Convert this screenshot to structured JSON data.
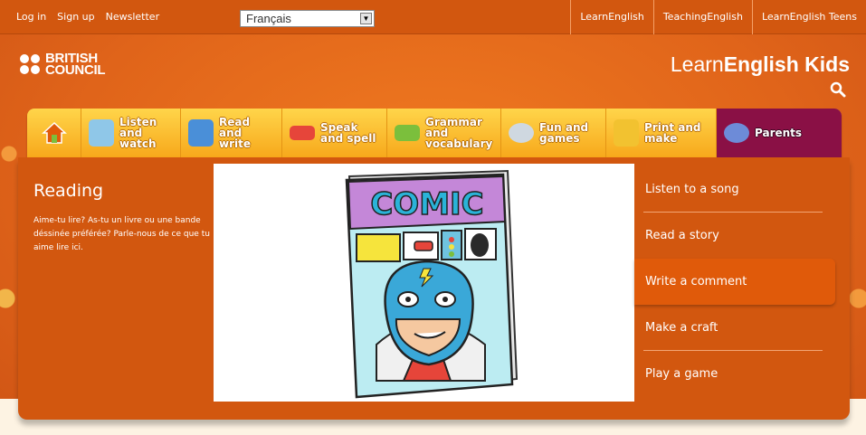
{
  "topbar": {
    "links": [
      "Log in",
      "Sign up",
      "Newsletter"
    ],
    "language": "Français",
    "external": [
      "LearnEnglish",
      "TeachingEnglish",
      "LearnEnglish Teens"
    ]
  },
  "header": {
    "bc_line1": "BRITISH",
    "bc_line2": "COUNCIL",
    "site_title_light": "Learn",
    "site_title_bold": "English Kids"
  },
  "nav": {
    "items": [
      {
        "label": "",
        "icon": "home-icon",
        "color": "#e05a0a"
      },
      {
        "label": "Listen and watch",
        "icon": "listen-watch-icon",
        "color": "#8fc7e8"
      },
      {
        "label": "Read and write",
        "icon": "book-icon",
        "color": "#4a8fd8"
      },
      {
        "label": "Speak and spell",
        "icon": "abc-icon",
        "color": "#e6453a"
      },
      {
        "label": "Grammar and vocabulary",
        "icon": "grammar-icon",
        "color": "#7bbf3c"
      },
      {
        "label": "Fun and games",
        "icon": "games-icon",
        "color": "#cfd8e0"
      },
      {
        "label": "Print and make",
        "icon": "print-icon",
        "color": "#f2c230"
      },
      {
        "label": "Parents",
        "icon": "parents-icon",
        "color": "#6d8bd8"
      }
    ]
  },
  "section": {
    "title": "Reading",
    "description": "Aime-tu lire? As-tu un livre ou une bande déssinée préférée? Parle-nous de ce que tu aime lire ici."
  },
  "comic": {
    "cover_text": "COMIC"
  },
  "menu": {
    "items": [
      "Listen to a song",
      "Read a story",
      "Write a comment",
      "Make a craft",
      "Play a game"
    ],
    "active_index": 2
  },
  "colors": {
    "brand_orange": "#d2570f",
    "nav_yellow": "#f7a81b",
    "parents_purple": "#8a1045"
  }
}
